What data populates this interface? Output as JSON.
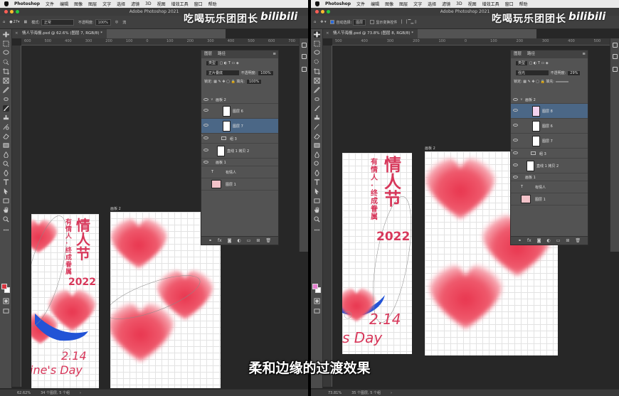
{
  "menu": {
    "app": "Photoshop",
    "items": [
      "文件",
      "编辑",
      "图像",
      "图层",
      "文字",
      "选择",
      "滤镜",
      "3D",
      "视图",
      "增效工具",
      "窗口",
      "帮助"
    ]
  },
  "window_title": "Adobe Photoshop 2021",
  "watermark": {
    "text": "吃喝玩乐团团长",
    "logo": "bilibili"
  },
  "caption": "柔和边缘的过渡效果",
  "left": {
    "options": {
      "brush_size": "27",
      "mode_label": "模式:",
      "mode_value": "正常",
      "opacity_label": "不透明度:",
      "opacity_value": "100%",
      "flow_label": "流"
    },
    "doc_tab": "情人节海报.psd @ 62.6% (图层 7, RGB/8) *",
    "ruler_ticks": [
      "600",
      "500",
      "400",
      "300",
      "200",
      "100",
      "0",
      "100",
      "200",
      "300",
      "400",
      "500",
      "600",
      "700"
    ],
    "artboard_label": "画板 2",
    "poster": {
      "title": "情人节",
      "subtitle": "有情人·终成眷属",
      "year": "2022",
      "date": "2.14",
      "tagline": "ine's Day"
    },
    "layers_panel": {
      "tabs": [
        "图层",
        "路径"
      ],
      "kind": "类型",
      "blend": "正片叠底",
      "opacity_label": "不透明度:",
      "opacity_value": "100%",
      "lock_label": "锁定:",
      "fill_label": "填充:",
      "fill_value": "100%",
      "rows": [
        {
          "type": "group",
          "name": "画板 2"
        },
        {
          "type": "layer",
          "name": "图层 6"
        },
        {
          "type": "layer",
          "name": "图层 7",
          "selected": true
        },
        {
          "type": "folder",
          "name": "组 3"
        },
        {
          "type": "layer",
          "name": "直线 1 拷贝 2"
        },
        {
          "type": "group",
          "name": "画板 1"
        },
        {
          "type": "text",
          "name": "有情人"
        },
        {
          "type": "layer",
          "name": "图层 1"
        }
      ]
    },
    "status": {
      "zoom": "62.62%",
      "info": "34 个图层, 5 个组"
    },
    "fg_color": "#d8343f"
  },
  "right": {
    "options": {
      "auto_select": "自动选择:",
      "auto_target": "图层",
      "show_transform": "显示变换控件"
    },
    "doc_tab": "情人节海报.psd @ 73.8% (图层 8, RGB/8) *",
    "ruler_ticks": [
      "500",
      "400",
      "300",
      "200",
      "100",
      "0",
      "100",
      "200",
      "300",
      "400",
      "500"
    ],
    "artboard_label": "画板 2",
    "poster": {
      "title": "情人节",
      "subtitle": "有情人·终成眷属",
      "year": "2022",
      "date": "2.14",
      "tagline": "s Day"
    },
    "layers_panel": {
      "tabs": [
        "图层",
        "路径"
      ],
      "kind": "类型",
      "blend": "强光",
      "opacity_label": "不透明度:",
      "opacity_value": "29%",
      "lock_label": "锁定:",
      "fill_label": "填充:",
      "rows": [
        {
          "type": "group",
          "name": "画板 2"
        },
        {
          "type": "layer",
          "name": "图层 8",
          "selected": true
        },
        {
          "type": "layer",
          "name": "图层 6"
        },
        {
          "type": "layer",
          "name": "图层 7"
        },
        {
          "type": "folder",
          "name": "组 3"
        },
        {
          "type": "layer",
          "name": "直线 1 拷贝 2"
        },
        {
          "type": "group",
          "name": "画板 1"
        },
        {
          "type": "text",
          "name": "有情人"
        },
        {
          "type": "layer",
          "name": "图层 1"
        }
      ]
    },
    "status": {
      "zoom": "73.81%",
      "info": "35 个图层, 5 个组"
    },
    "fg_color": "#e67fd0"
  }
}
